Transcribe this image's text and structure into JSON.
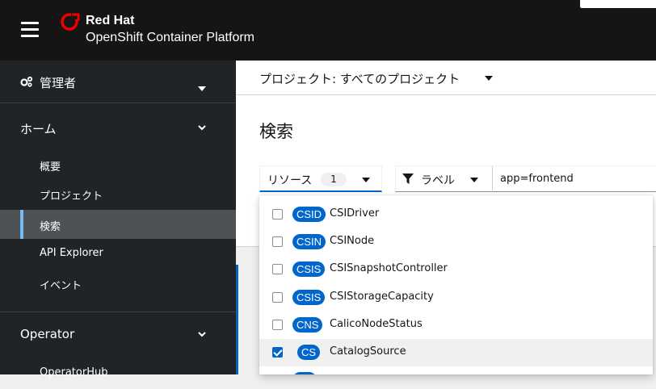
{
  "masthead": {
    "brand_top": "Red Hat",
    "brand_bottom": "OpenShift Container Platform",
    "menu_icon": "hamburger-icon",
    "logo_icon": "redhat-logo-icon"
  },
  "sidebar": {
    "perspective": {
      "label": "管理者",
      "icon": "gears-icon"
    },
    "home": {
      "label": "ホーム",
      "items": [
        {
          "label": "概要",
          "active": false
        },
        {
          "label": "プロジェクト",
          "active": false
        },
        {
          "label": "検索",
          "active": true
        },
        {
          "label": "API Explorer",
          "active": false
        },
        {
          "label": "イベント",
          "active": false
        }
      ]
    },
    "operator": {
      "label": "Operator",
      "items": [
        {
          "label": "OperatorHub"
        }
      ]
    }
  },
  "main": {
    "project_selector": "プロジェクト: すべてのプロジェクト",
    "page_title": "検索",
    "resource_toggle": {
      "label": "リソース",
      "count": "1"
    },
    "label_toggle": {
      "label": "ラベル"
    },
    "search_value": "app=frontend"
  },
  "resource_menu": {
    "items": [
      {
        "badge": "CSID",
        "name": "CSIDriver",
        "checked": false
      },
      {
        "badge": "CSIN",
        "name": "CSINode",
        "checked": false
      },
      {
        "badge": "CSIS",
        "name": "CSISnapshotController",
        "checked": false
      },
      {
        "badge": "CSIS",
        "name": "CSIStorageCapacity",
        "checked": false
      },
      {
        "badge": "CNS",
        "name": "CalicoNodeStatus",
        "checked": false
      },
      {
        "badge": "CS",
        "name": "CatalogSource",
        "checked": true
      }
    ]
  },
  "colors": {
    "accent": "#0066cc",
    "masthead_bg": "#151515",
    "sidebar_bg": "#212427",
    "active_indicator": "#73bcf7",
    "brand_red": "#ee0000"
  }
}
